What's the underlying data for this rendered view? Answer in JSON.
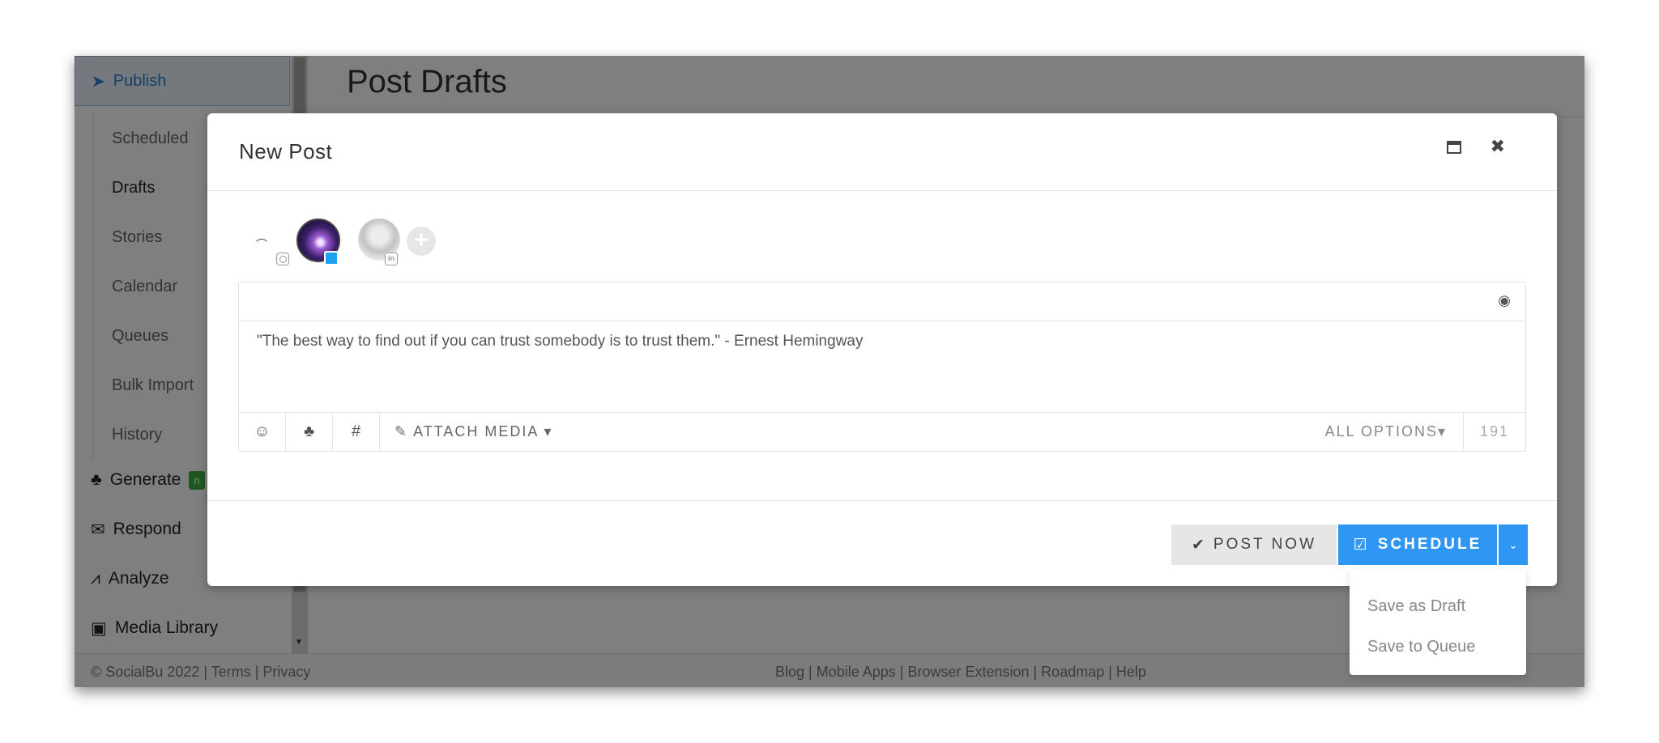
{
  "sidebar": {
    "publish_label": "Publish",
    "sub_items": [
      "Scheduled",
      "Drafts",
      "Stories",
      "Calendar",
      "Queues",
      "Bulk Import",
      "History"
    ],
    "active_sub": "Drafts",
    "main_items": [
      {
        "label": "Generate",
        "badge": "n",
        "icon": "robot-icon"
      },
      {
        "label": "Respond",
        "icon": "chat-icon"
      },
      {
        "label": "Analyze",
        "icon": "chart-icon"
      },
      {
        "label": "Media Library",
        "icon": "image-file-icon"
      }
    ]
  },
  "content": {
    "title": "Post Drafts"
  },
  "footer": {
    "left": "© SocialBu 2022 | Terms | Privacy",
    "center": "Blog | Mobile Apps | Browser Extension | Roadmap | Help"
  },
  "modal": {
    "title": "New Post",
    "post_text": "\"The best way to find out if you can trust somebody is to trust them.\" - Ernest Hemingway",
    "toolbar": {
      "attach_label": "ATTACH MEDIA",
      "options_label": "ALL OPTIONS",
      "char_count": "191"
    },
    "post_now_label": "POST NOW",
    "schedule_label": "SCHEDULE",
    "dropdown": [
      "Save as Draft",
      "Save to Queue"
    ]
  },
  "colors": {
    "accent": "#2f96f3",
    "badge_green": "#3cb043",
    "twitter": "#1da1f2"
  }
}
